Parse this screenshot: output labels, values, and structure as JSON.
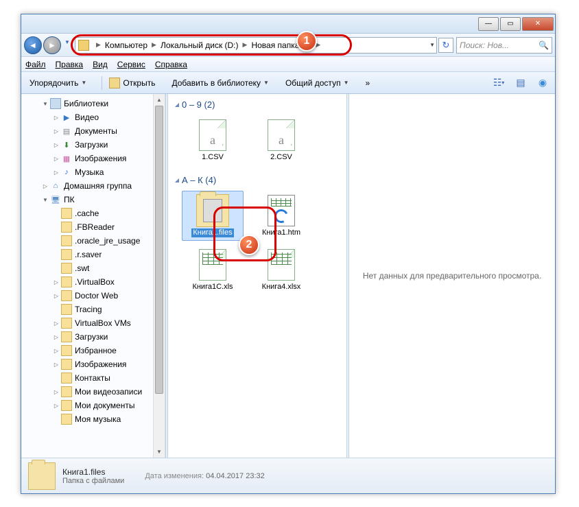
{
  "titlebar": {
    "min": "—",
    "max": "▭",
    "close": "✕"
  },
  "nav": {
    "breadcrumb": [
      "Компьютер",
      "Локальный диск (D:)",
      "Новая папка (2)"
    ],
    "search_placeholder": "Поиск: Нов...",
    "refresh_glyph": "↻"
  },
  "menu": {
    "items": [
      "Файл",
      "Правка",
      "Вид",
      "Сервис",
      "Справка"
    ]
  },
  "toolbar": {
    "organize": "Упорядочить",
    "open": "Открыть",
    "addlib": "Добавить в библиотеку",
    "share": "Общий доступ",
    "more": "»"
  },
  "tree": [
    {
      "lvl": 0,
      "icon": "lib",
      "label": "Библиотеки",
      "tri": "▼"
    },
    {
      "lvl": 1,
      "icon": "video",
      "label": "Видео",
      "tri": "▷"
    },
    {
      "lvl": 1,
      "icon": "doc",
      "label": "Документы",
      "tri": "▷"
    },
    {
      "lvl": 1,
      "icon": "down",
      "label": "Загрузки",
      "tri": "▷"
    },
    {
      "lvl": 1,
      "icon": "img",
      "label": "Изображения",
      "tri": "▷"
    },
    {
      "lvl": 1,
      "icon": "music",
      "label": "Музыка",
      "tri": "▷"
    },
    {
      "lvl": 0,
      "icon": "home",
      "label": "Домашняя группа",
      "tri": "▷"
    },
    {
      "lvl": 0,
      "icon": "pc",
      "label": "ПК",
      "tri": "▼"
    },
    {
      "lvl": 1,
      "icon": "fld",
      "label": ".cache",
      "tri": ""
    },
    {
      "lvl": 1,
      "icon": "fld",
      "label": ".FBReader",
      "tri": ""
    },
    {
      "lvl": 1,
      "icon": "fld",
      "label": ".oracle_jre_usage",
      "tri": ""
    },
    {
      "lvl": 1,
      "icon": "fld",
      "label": ".r.saver",
      "tri": ""
    },
    {
      "lvl": 1,
      "icon": "fld",
      "label": ".swt",
      "tri": ""
    },
    {
      "lvl": 1,
      "icon": "fld",
      "label": ".VirtualBox",
      "tri": "▷"
    },
    {
      "lvl": 1,
      "icon": "fld",
      "label": "Doctor Web",
      "tri": "▷"
    },
    {
      "lvl": 1,
      "icon": "fld",
      "label": "Tracing",
      "tri": ""
    },
    {
      "lvl": 1,
      "icon": "fld",
      "label": "VirtualBox VMs",
      "tri": "▷"
    },
    {
      "lvl": 1,
      "icon": "fld",
      "label": "Загрузки",
      "tri": "▷"
    },
    {
      "lvl": 1,
      "icon": "fld",
      "label": "Избранное",
      "tri": "▷"
    },
    {
      "lvl": 1,
      "icon": "fld",
      "label": "Изображения",
      "tri": "▷"
    },
    {
      "lvl": 1,
      "icon": "fld",
      "label": "Контакты",
      "tri": ""
    },
    {
      "lvl": 1,
      "icon": "fld",
      "label": "Мои видеозаписи",
      "tri": "▷"
    },
    {
      "lvl": 1,
      "icon": "fld",
      "label": "Мои документы",
      "tri": "▷"
    },
    {
      "lvl": 1,
      "icon": "fld",
      "label": "Моя музыка",
      "tri": ""
    }
  ],
  "groups": [
    {
      "header": "0 – 9 (2)",
      "tri": "◢",
      "items": [
        {
          "type": "csv",
          "label": "1.CSV"
        },
        {
          "type": "csv",
          "label": "2.CSV"
        }
      ]
    },
    {
      "header": "А – К (4)",
      "tri": "◢",
      "items": [
        {
          "type": "folder",
          "label": "Книга1.files",
          "selected": true
        },
        {
          "type": "htm",
          "label": "Книга1.htm"
        },
        {
          "type": "xls",
          "label": "Книга1C.xls"
        },
        {
          "type": "xlsx",
          "label": "Книга4.xlsx"
        }
      ]
    }
  ],
  "preview": {
    "empty": "Нет данных для предварительного просмотра."
  },
  "status": {
    "name": "Книга1.files",
    "type": "Папка с файлами",
    "mod_label": "Дата изменения:",
    "mod_value": "04.04.2017 23:32"
  },
  "badges": {
    "b1": "1",
    "b2": "2"
  }
}
